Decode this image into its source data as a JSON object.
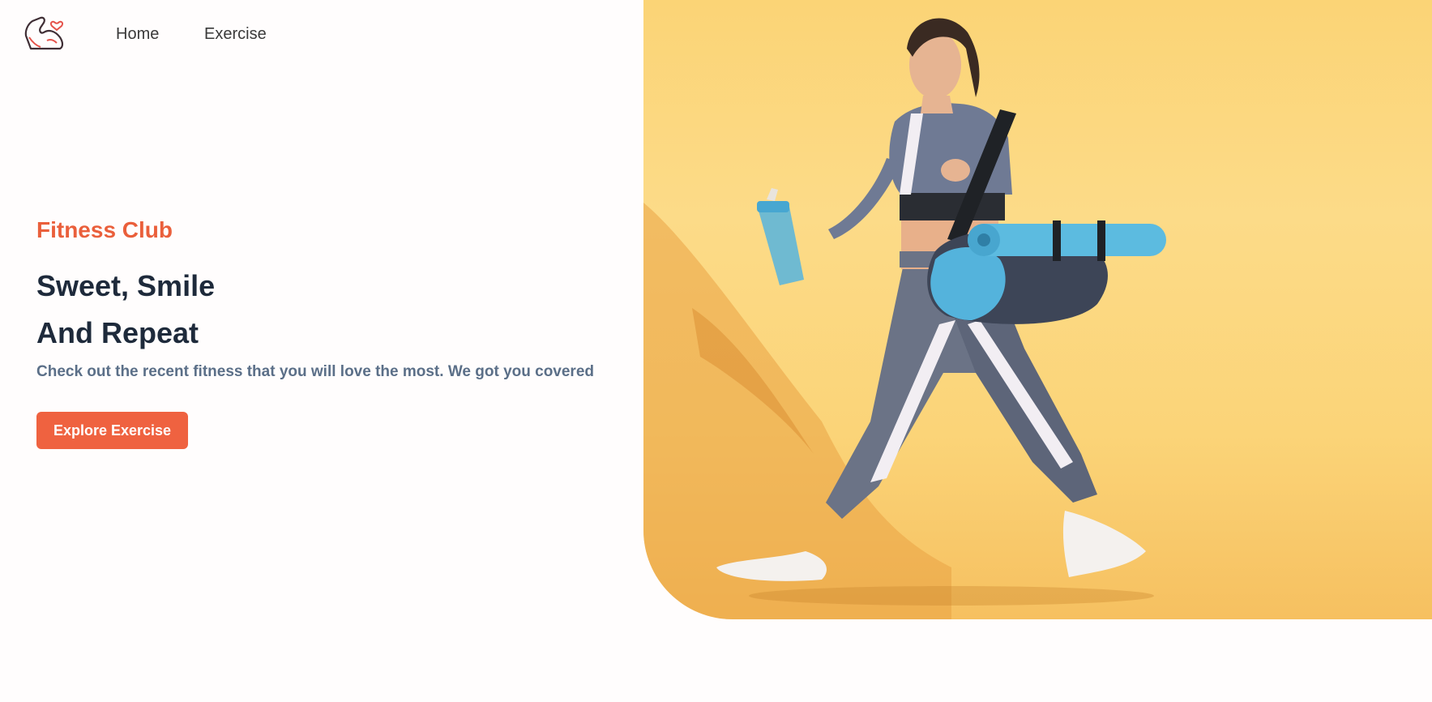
{
  "nav": {
    "logo_icon": "flexed-arm-heart-icon",
    "home_label": "Home",
    "exercise_label": "Exercise"
  },
  "hero": {
    "brand": "Fitness Club",
    "headline_line1": "Sweet, Smile",
    "headline_line2": "And Repeat",
    "subtitle": "Check out the recent fitness that you will love the most. We got you covered",
    "cta_label": "Explore Exercise",
    "image_alt": "woman-walking-with-yoga-mat-and-shaker-photo"
  },
  "colors": {
    "accent": "#ef6240",
    "headline": "#1e2a3b",
    "subtitle": "#5b6f88",
    "image_background": "#fbd476"
  }
}
